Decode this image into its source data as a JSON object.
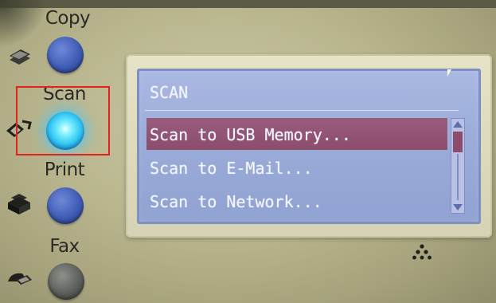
{
  "control_panel": {
    "modes": [
      {
        "label": "Copy",
        "icon": "copy-icon",
        "state": "off"
      },
      {
        "label": "Scan",
        "icon": "scan-icon",
        "state": "lit"
      },
      {
        "label": "Print",
        "icon": "print-icon",
        "state": "off"
      },
      {
        "label": "Fax",
        "icon": "fax-icon",
        "state": "off"
      }
    ],
    "highlighted_mode": "Scan",
    "colors": {
      "panel": "#b9b68f",
      "button_blue": "#3f5cb6",
      "scan_lit": "#2fc4f2",
      "fax_gray": "#5c5e5a",
      "highlight_box": "#e2231a"
    }
  },
  "lcd": {
    "title": "SCAN",
    "menu_items": [
      {
        "label": "Scan to USB Memory...",
        "selected": true
      },
      {
        "label": "Scan to E-Mail...",
        "selected": false
      },
      {
        "label": "Scan to Network...",
        "selected": false
      }
    ],
    "scrollbar": {
      "up_icon": "arrow-up-icon",
      "down_icon": "arrow-down-icon"
    },
    "colors": {
      "background": "#9aabd8",
      "text": "#f4f6ff",
      "selection": "#8c4d6c"
    }
  },
  "brand_logo": "three-dot-triangle-logo"
}
